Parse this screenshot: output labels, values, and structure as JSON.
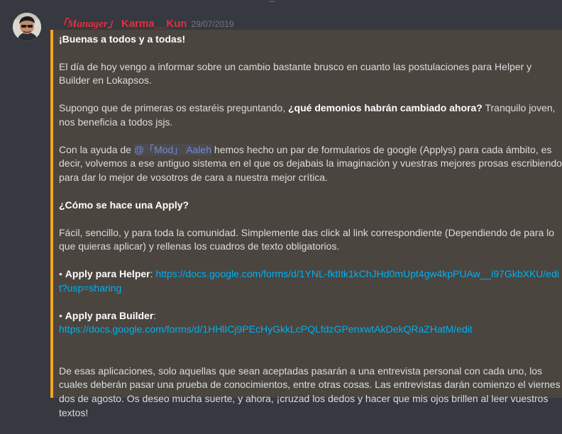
{
  "author": {
    "role_tag": "「Manager」",
    "name": "Karma__Kun",
    "timestamp": "29/07/2019"
  },
  "message": {
    "greeting": "¡Buenas a todos y a todas!",
    "p1": "El día de hoy vengo a informar sobre un cambio bastante brusco en cuanto las postulaciones para Helper y Builder en Lokapsos.",
    "p2_pre": "Supongo que de primeras os estaréis preguntando, ",
    "p2_bold": "¿qué demonios habrán cambiado ahora?",
    "p2_post": " Tranquilo joven, nos beneficia a todos jsjs.",
    "p3_pre": "Con la ayuda de ",
    "p3_mention": "@「Mod」 Aaleh",
    "p3_post": " hemos hecho un par de formularios de google (Applys) para cada ámbito, es decir, volvemos a ese antiguo sistema en el que os dejabais la imaginación y vuestras mejores prosas escribiendo para dar lo mejor de vosotros de cara a nuestra mejor crítica.",
    "how_heading": "¿Cómo se hace una Apply?",
    "p4": "Fácil, sencillo, y para toda la comunidad. Simplemente das click al link correspondiente (Dependiendo de para lo que quieras aplicar) y rellenas los cuadros de texto obligatorios.",
    "helper_bullet": " • ",
    "helper_label": "Apply para Helper",
    "helper_colon": ": ",
    "helper_link": "https://docs.google.com/forms/d/1YNL-fktItk1kChJHd0mUpt4gw4kpPUAw__i97GkbXKU/edit?usp=sharing",
    "builder_bullet": " • ",
    "builder_label": "Apply para Builder",
    "builder_colon": ":",
    "builder_link": "https://docs.google.com/forms/d/1HHlICj9PEcHyGkkLcPQLfdzGPenxwtAkDekQRaZHatM/edit",
    "p5": "De esas aplicaciones, solo aquellas que sean aceptadas pasarán a una entrevista personal con cada uno, los cuales deberán pasar una prueba de conocimientos, entre otras cosas. Las entrevistas darán comienzo el viernes dos de agosto. Os deseo mucha suerte, y ahora, ¡cruzad los dedos y hacer que mis ojos brillen al leer vuestros textos!"
  },
  "colors": {
    "background": "#36393f",
    "embed_background": "#4a453e",
    "embed_border": "#f5a623",
    "username": "#e0303f",
    "link": "#00b0f4",
    "mention": "#7289da"
  }
}
